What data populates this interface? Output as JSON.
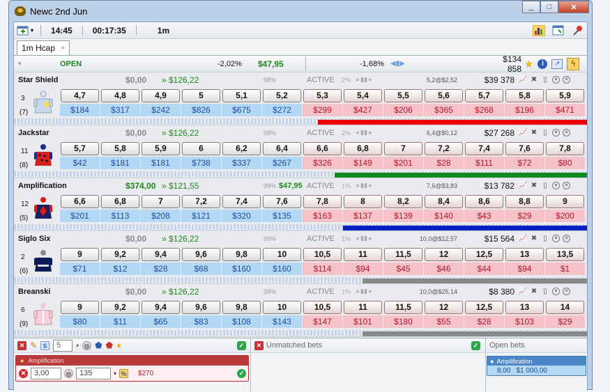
{
  "window": {
    "title": "Newc 2nd Jun",
    "buttons": [
      "_",
      "□",
      "✕"
    ]
  },
  "toolbar": {
    "time": "14:45",
    "countdown": "00:17:35",
    "distance": "1m"
  },
  "tab": {
    "label": "1m Hcap",
    "close": "×"
  },
  "market": {
    "status": "OPEN",
    "back_pct": "-2,02%",
    "back_sum": "$47,95",
    "lay_pct": "-1,68%",
    "total_matched": "$134 858"
  },
  "runners": [
    {
      "name": "Star Shield",
      "number": "3",
      "rank": "(7)",
      "bet": "$0,00",
      "profit": "» $126,22",
      "pct": "98%",
      "pl": "",
      "status": "ACTIVE",
      "pct2": "2%",
      "last": "5,2@$2,52",
      "volume": "$39 378",
      "back": [
        {
          "price": "4,7",
          "amt": "$184"
        },
        {
          "price": "4,8",
          "amt": "$317"
        },
        {
          "price": "4,9",
          "amt": "$242"
        },
        {
          "price": "5",
          "amt": "$826"
        },
        {
          "price": "5,1",
          "amt": "$675"
        },
        {
          "price": "5,2",
          "amt": "$272"
        }
      ],
      "lay": [
        {
          "price": "5,3",
          "amt": "$299"
        },
        {
          "price": "5,4",
          "amt": "$427"
        },
        {
          "price": "5,5",
          "amt": "$206"
        },
        {
          "price": "5,6",
          "amt": "$365"
        },
        {
          "price": "5,7",
          "amt": "$268"
        },
        {
          "price": "5,8",
          "amt": "$196"
        },
        {
          "price": "5,9",
          "amt": "$471"
        }
      ],
      "bar_color": "#ee0000",
      "bar_level": 0.96,
      "silk": "silk-star"
    },
    {
      "name": "Jackstar",
      "number": "11",
      "rank": "(8)",
      "bet": "$0,00",
      "profit": "» $126,22",
      "pct": "98%",
      "pl": "",
      "status": "ACTIVE",
      "pct2": "2%",
      "last": "6,4@$0,12",
      "volume": "$27 268",
      "back": [
        {
          "price": "5,7",
          "amt": "$42"
        },
        {
          "price": "5,8",
          "amt": "$181"
        },
        {
          "price": "5,9",
          "amt": "$181"
        },
        {
          "price": "6",
          "amt": "$738"
        },
        {
          "price": "6,2",
          "amt": "$337"
        },
        {
          "price": "6,4",
          "amt": "$267"
        }
      ],
      "lay": [
        {
          "price": "6,6",
          "amt": "$326"
        },
        {
          "price": "6,8",
          "amt": "$149"
        },
        {
          "price": "7",
          "amt": "$201"
        },
        {
          "price": "7,2",
          "amt": "$28"
        },
        {
          "price": "7,4",
          "amt": "$111"
        },
        {
          "price": "7,6",
          "amt": "$72"
        },
        {
          "price": "7,8",
          "amt": "$80"
        }
      ],
      "bar_color": "#0e8a1e",
      "bar_level": 0.9,
      "silk": "silk-jack"
    },
    {
      "name": "Amplification",
      "number": "12",
      "rank": "(5)",
      "bet": "$374,00",
      "profit": "» $121,55",
      "pct": "99%",
      "pl": "$47,95",
      "status": "ACTIVE",
      "pct2": "1%",
      "last": "7,6@$3,83",
      "volume": "$13 782",
      "back": [
        {
          "price": "6,6",
          "amt": "$201"
        },
        {
          "price": "6,8",
          "amt": "$113"
        },
        {
          "price": "7",
          "amt": "$208"
        },
        {
          "price": "7,2",
          "amt": "$121"
        },
        {
          "price": "7,4",
          "amt": "$320"
        },
        {
          "price": "7,6",
          "amt": "$135"
        }
      ],
      "lay": [
        {
          "price": "7,8",
          "amt": "$163"
        },
        {
          "price": "8",
          "amt": "$137"
        },
        {
          "price": "8,2",
          "amt": "$139"
        },
        {
          "price": "8,4",
          "amt": "$140"
        },
        {
          "price": "8,6",
          "amt": "$43"
        },
        {
          "price": "8,8",
          "amt": "$29"
        },
        {
          "price": "9",
          "amt": "$200"
        }
      ],
      "bar_color": "#0a1fc0",
      "bar_level": 0.87,
      "silk": "silk-amp"
    },
    {
      "name": "Siglo Six",
      "number": "2",
      "rank": "(6)",
      "bet": "$0,00",
      "profit": "» $126,22",
      "pct": "99%",
      "pl": "",
      "status": "ACTIVE",
      "pct2": "1%",
      "last": "10,0@$12,57",
      "volume": "$15 564",
      "back": [
        {
          "price": "9",
          "amt": "$71"
        },
        {
          "price": "9,2",
          "amt": "$12"
        },
        {
          "price": "9,4",
          "amt": "$28"
        },
        {
          "price": "9,6",
          "amt": "$68"
        },
        {
          "price": "9,8",
          "amt": "$160"
        },
        {
          "price": "10",
          "amt": "$160"
        }
      ],
      "lay": [
        {
          "price": "10,5",
          "amt": "$114"
        },
        {
          "price": "11",
          "amt": "$94"
        },
        {
          "price": "11,5",
          "amt": "$45"
        },
        {
          "price": "12",
          "amt": "$46"
        },
        {
          "price": "12,5",
          "amt": "$44"
        },
        {
          "price": "13",
          "amt": "$94"
        },
        {
          "price": "13,5",
          "amt": "$1"
        }
      ],
      "bar_color": "#888888",
      "bar_level": 0.8,
      "silk": "silk-siglo"
    },
    {
      "name": "Breanski",
      "number": "6",
      "rank": "(9)",
      "bet": "$0,00",
      "profit": "» $126,22",
      "pct": "99%",
      "pl": "",
      "status": "ACTIVE",
      "pct2": "1%",
      "last": "10,0@$25,14",
      "volume": "$8 380",
      "back": [
        {
          "price": "9",
          "amt": "$80"
        },
        {
          "price": "9,2",
          "amt": "$11"
        },
        {
          "price": "9,4",
          "amt": "$65"
        },
        {
          "price": "9,6",
          "amt": "$83"
        },
        {
          "price": "9,8",
          "amt": "$108"
        },
        {
          "price": "10",
          "amt": "$143"
        }
      ],
      "lay": [
        {
          "price": "10,5",
          "amt": "$147"
        },
        {
          "price": "11",
          "amt": "$101"
        },
        {
          "price": "11,5",
          "amt": "$180"
        },
        {
          "price": "12",
          "amt": "$55"
        },
        {
          "price": "12,5",
          "amt": "$28"
        },
        {
          "price": "13",
          "amt": "$103"
        },
        {
          "price": "14",
          "amt": "$29"
        }
      ],
      "bar_color": "#888888",
      "bar_level": 0.8,
      "silk": "silk-bre"
    }
  ],
  "betslip": {
    "stake_steps": "5",
    "selection": "Amplification",
    "odds": "3,00",
    "stake": "135",
    "liability": "$270"
  },
  "unmatched": {
    "title": "Unmatched bets"
  },
  "open_bets": {
    "title": "Open bets",
    "selection": "Amplification",
    "odds": "8,00",
    "stake": "$1 000,00"
  }
}
